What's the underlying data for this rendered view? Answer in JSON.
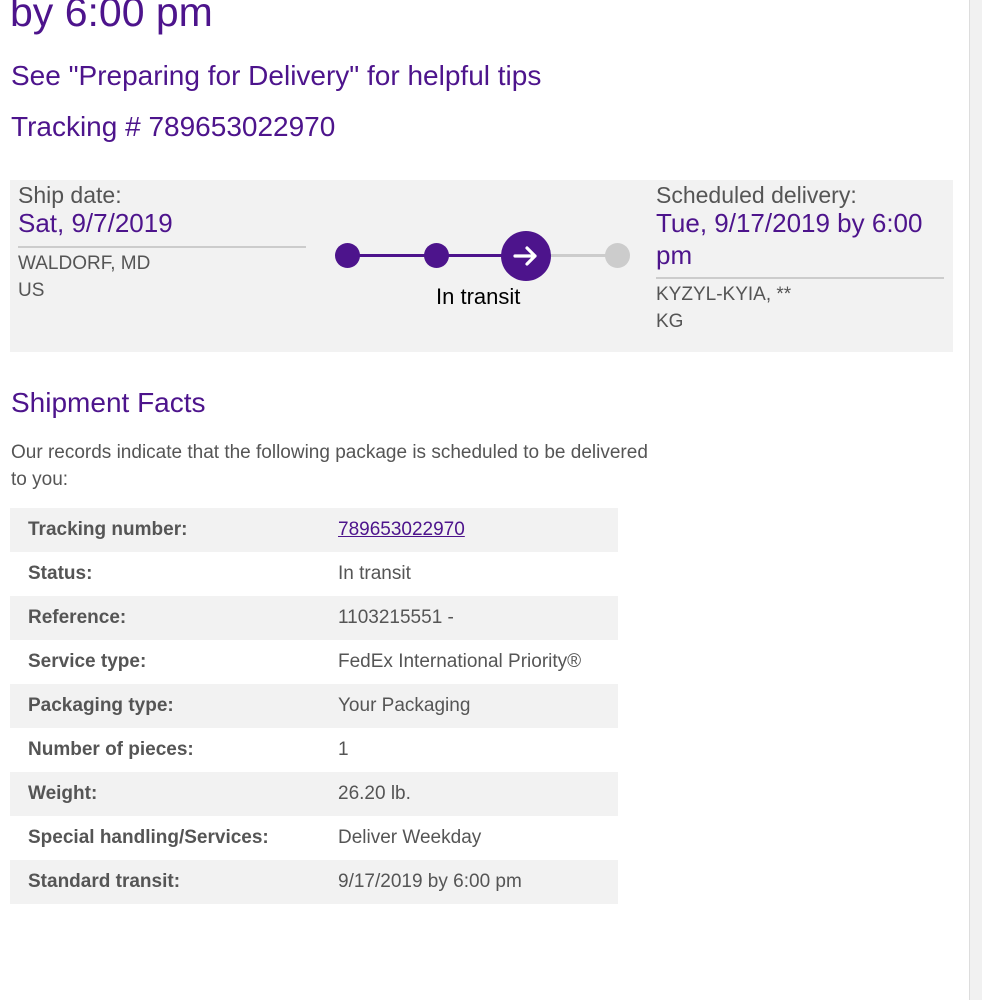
{
  "header": {
    "delivery_time": "by 6:00 pm",
    "tips_link": "See \"Preparing for Delivery\" for helpful tips",
    "tracking_line": "Tracking # 789653022970"
  },
  "status_panel": {
    "ship": {
      "label": "Ship date:",
      "date": "Sat, 9/7/2019",
      "city": "WALDORF, MD",
      "country": "US"
    },
    "delivery": {
      "label": "Scheduled delivery:",
      "date": "Tue, 9/17/2019 by 6:00 pm",
      "city": "KYZYL-KYIA, **",
      "country": "KG"
    },
    "progress": {
      "status_label": "In transit",
      "steps_total": 4,
      "current_step": 3,
      "current_icon": "arrow-right-icon"
    }
  },
  "shipment_facts": {
    "title": "Shipment Facts",
    "intro": "Our records indicate that the following package is scheduled to be delivered to you:",
    "rows": [
      {
        "label": "Tracking number:",
        "value": "789653022970"
      },
      {
        "label": "Status:",
        "value": "In transit"
      },
      {
        "label": "Reference:",
        "value": "1103215551 -"
      },
      {
        "label": "Service type:",
        "value": "FedEx International Priority®"
      },
      {
        "label": "Packaging type:",
        "value": "Your Packaging"
      },
      {
        "label": "Number of pieces:",
        "value": "1"
      },
      {
        "label": "Weight:",
        "value": "26.20 lb."
      },
      {
        "label": "Special handling/Services:",
        "value": "Deliver Weekday"
      },
      {
        "label": "Standard transit:",
        "value": "9/17/2019 by 6:00 pm"
      }
    ]
  },
  "colors": {
    "brand_purple": "#4d148c",
    "pending_gray": "#cccccc",
    "panel_bg": "#f2f2f2"
  }
}
